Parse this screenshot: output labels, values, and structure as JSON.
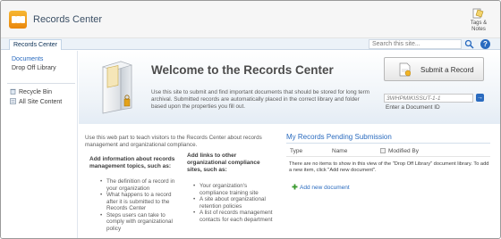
{
  "header": {
    "site_title": "Records Center",
    "tags_line1": "Tags &",
    "tags_line2": "Notes"
  },
  "nav": {
    "tab_label": "Records Center",
    "search_placeholder": "Search this site...",
    "help_glyph": "?"
  },
  "sidebar": {
    "heading": "Documents",
    "items": [
      {
        "label": "Drop Off Library"
      }
    ],
    "links": [
      {
        "label": "Recycle Bin",
        "icon": "recycle-bin-icon"
      },
      {
        "label": "All Site Content",
        "icon": "all-site-content-icon"
      }
    ]
  },
  "welcome": {
    "title": "Welcome to the Records Center",
    "body": "Use this site to submit and find important documents that should be stored for long term archival. Submitted records are automatically placed in the correct library and folder based upon the properties you fill out.",
    "submit_label": "Submit a Record",
    "doc_id_value": "3WHPMIKISSUT-1-1",
    "doc_id_label": "Enter a Document ID"
  },
  "info_part": {
    "intro": "Use this web part to teach visitors to the Records Center about records management and organizational compliance.",
    "left_heading": "Add information about records management topics, such as:",
    "left_items": [
      "The definition of a record in your organization",
      "What happens to a record after it is submitted to the Records Center",
      "Steps users can take to comply with organizational policy"
    ],
    "right_heading": "Add links to other organizational compliance sites, such as:",
    "right_items": [
      "Your organization's compliance training site",
      "A site about organizational retention policies",
      "A list of records management contacts for each department"
    ]
  },
  "pending": {
    "title": "My Records Pending Submission",
    "col_type": "Type",
    "col_name": "Name",
    "col_modified": "Modified By",
    "empty_message": "There are no items to show in this view of the \"Drop Off Library\" document library. To add a new item, click \"Add new document\".",
    "add_label": "Add new document"
  },
  "colors": {
    "link_blue": "#2a6bbf",
    "header_bg": "#f6f6f6",
    "logo_orange": "#e9870c"
  }
}
